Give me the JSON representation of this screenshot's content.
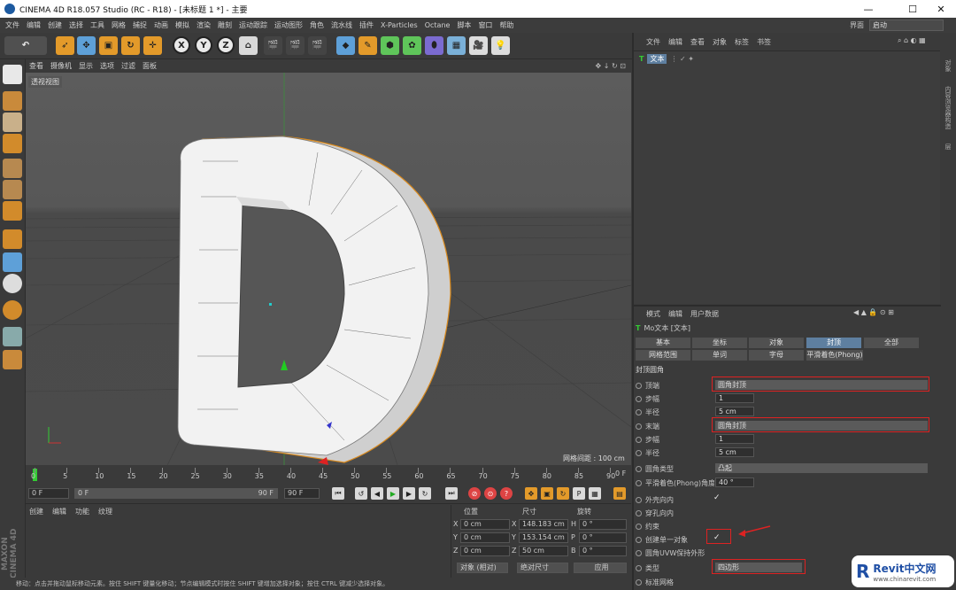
{
  "window": {
    "title": "CINEMA 4D R18.057 Studio (RC - R18) - [未标题 1 *] - 主要",
    "min": "—",
    "max": "☐",
    "close": "✕"
  },
  "menu": {
    "items": [
      "文件",
      "编辑",
      "创建",
      "选择",
      "工具",
      "网格",
      "捕捉",
      "动画",
      "模拟",
      "渲染",
      "雕刻",
      "运动跟踪",
      "运动图形",
      "角色",
      "流水线",
      "插件",
      "X-Particles",
      "Octane",
      "脚本",
      "窗口",
      "帮助"
    ],
    "layout_label": "界面",
    "layout_value": "启动"
  },
  "toolbar": {
    "x": "X",
    "y": "Y",
    "z": "Z"
  },
  "viewport": {
    "menu": [
      "查看",
      "摄像机",
      "显示",
      "选项",
      "过滤",
      "面板"
    ],
    "label": "透视视图",
    "grid_info": "网格间距 : 100 cm"
  },
  "timeline": {
    "ticks": [
      "0",
      "5",
      "10",
      "15",
      "20",
      "25",
      "30",
      "35",
      "40",
      "45",
      "50",
      "55",
      "60",
      "65",
      "70",
      "75",
      "80",
      "85",
      "90"
    ],
    "end": "0 F",
    "start_field": "0 F",
    "slider_left": "0 F",
    "slider_right": "90 F",
    "end_field": "90 F"
  },
  "material": {
    "menu": [
      "创建",
      "编辑",
      "功能",
      "纹理"
    ]
  },
  "coords": {
    "headers": [
      "位置",
      "尺寸",
      "旋转"
    ],
    "rows": [
      {
        "axis": "X",
        "pos": "0 cm",
        "size_axis": "X",
        "size": "148.183 cm",
        "rot_axis": "H",
        "rot": "0 °"
      },
      {
        "axis": "Y",
        "pos": "0 cm",
        "size_axis": "Y",
        "size": "153.154 cm",
        "rot_axis": "P",
        "rot": "0 °"
      },
      {
        "axis": "Z",
        "pos": "0 cm",
        "size_axis": "Z",
        "size": "50 cm",
        "rot_axis": "B",
        "rot": "0 °"
      }
    ],
    "mode1": "对象 (相对)",
    "mode2": "绝对尺寸",
    "apply": "应用"
  },
  "brand": "MAXON CINEMA 4D",
  "objects": {
    "menu": [
      "文件",
      "编辑",
      "查看",
      "对象",
      "标签",
      "书签"
    ],
    "items": [
      {
        "name": "文本"
      }
    ]
  },
  "right_tabs": [
    "对象",
    "内容浏览器",
    "构造",
    "层"
  ],
  "attributes": {
    "menu": [
      "模式",
      "编辑",
      "用户数据"
    ],
    "title": "Mo文本 [文本]",
    "tabs_row1": [
      "基本",
      "坐标",
      "对象",
      "封顶",
      "全部"
    ],
    "tabs_row2": [
      "网格范围",
      "单词",
      "字母",
      "平滑着色(Phong)"
    ],
    "section": "封顶圆角",
    "rows": [
      {
        "label": "顶端",
        "value": "圆角封顶",
        "kind": "dropdown"
      },
      {
        "label": "步幅",
        "value": "1",
        "kind": "field"
      },
      {
        "label": "半径",
        "value": "5 cm",
        "kind": "field"
      },
      {
        "label": "末端",
        "value": "圆角封顶",
        "kind": "dropdown"
      },
      {
        "label": "步幅",
        "value": "1",
        "kind": "field"
      },
      {
        "label": "半径",
        "value": "5 cm",
        "kind": "field"
      },
      {
        "label": "圆角类型",
        "value": "凸起",
        "kind": "dropdown"
      },
      {
        "label": "平滑着色(Phong)角度",
        "value": "40 °",
        "kind": "field"
      },
      {
        "label": "外壳向内",
        "value": "✓",
        "kind": "check"
      },
      {
        "label": "穿孔向内",
        "value": "",
        "kind": "check"
      },
      {
        "label": "约束",
        "value": "",
        "kind": "check"
      },
      {
        "label": "创建单一对象",
        "value": "✓",
        "kind": "check"
      },
      {
        "label": "圆角UVW保持外形",
        "value": "",
        "kind": "check"
      },
      {
        "label": "类型",
        "value": "四边形",
        "kind": "dropdown"
      },
      {
        "label": "标准网格",
        "value": "",
        "kind": "check"
      }
    ]
  },
  "watermark": {
    "brand": "Revit中文网",
    "url": "www.chinarevit.com"
  },
  "status": "移动：点击并拖动鼠标移动元素。按住 SHIFT 键量化移动；节点编辑模式时按住 SHIFT 键增加选择对象；按住 CTRL 键减少选择对象。",
  "colors": {
    "accent": "#5e7fa0",
    "highlight": "#d22222",
    "model_outline": "#d98a1e",
    "cap_active_tab": "#5e7fa0"
  }
}
